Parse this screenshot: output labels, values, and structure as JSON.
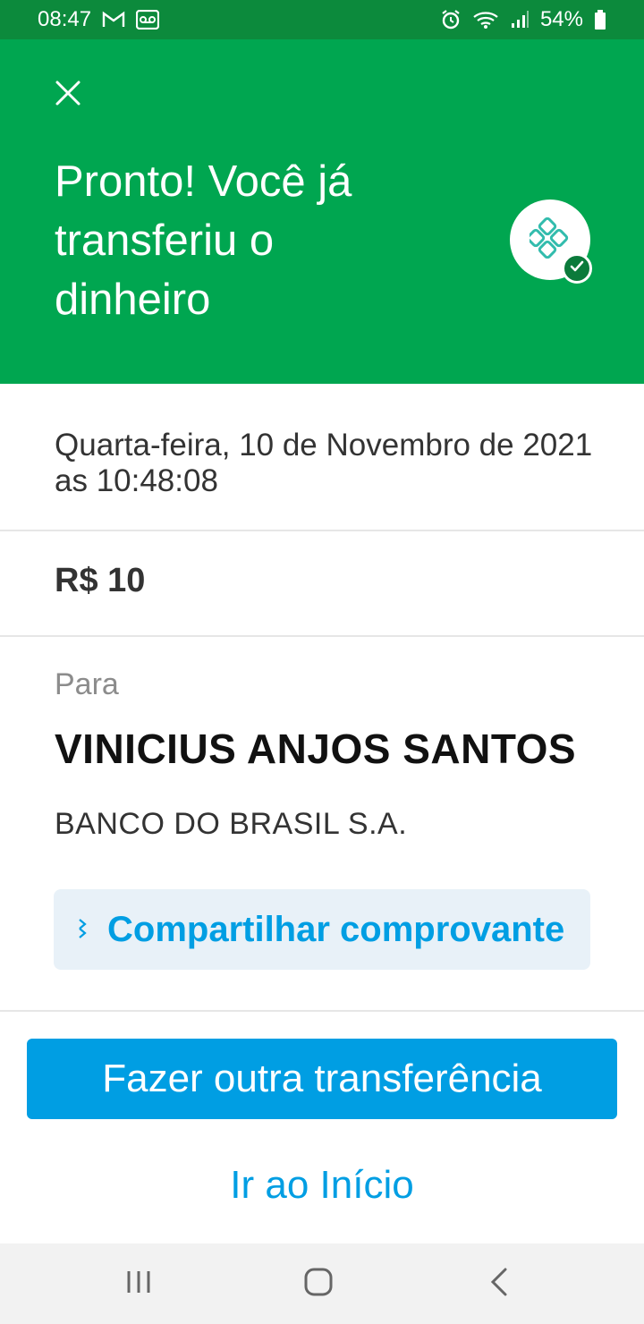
{
  "status_bar": {
    "time": "08:47",
    "battery": "54%",
    "icons": [
      "gmail-icon",
      "voicemail-icon",
      "alarm-icon",
      "wifi-icon",
      "signal-icon",
      "battery-icon"
    ]
  },
  "header": {
    "title": "Pronto! Você já transferiu o dinheiro",
    "close_icon": "close-icon",
    "badge_icon": "pix-icon",
    "background_color": "#00a650"
  },
  "transfer": {
    "datetime": "Quarta-feira, 10 de Novembro de 2021 as 10:48:08",
    "amount": "R$ 10",
    "to_label": "Para",
    "recipient_name": "VINICIUS ANJOS SANTOS",
    "bank": "BANCO DO BRASIL S.A."
  },
  "actions": {
    "share_label": "Compartilhar comprovante",
    "primary_label": "Fazer outra transferência",
    "secondary_label": "Ir ao Início",
    "accent_color": "#009ee3"
  },
  "nav_bar": {
    "icons": [
      "recent-apps-icon",
      "home-icon",
      "back-icon"
    ]
  }
}
